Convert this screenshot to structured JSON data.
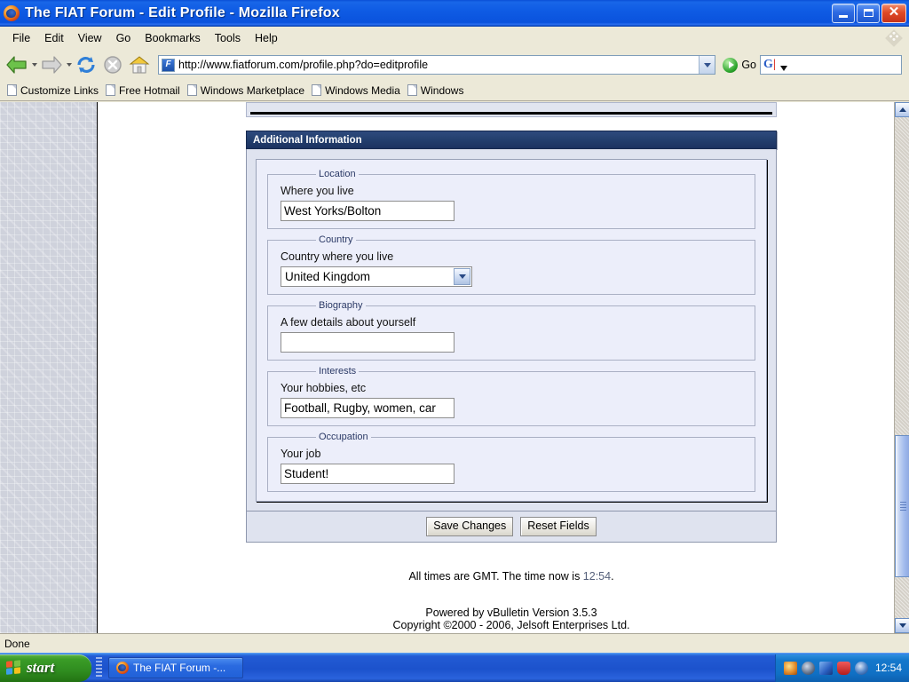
{
  "window": {
    "title": "The FIAT Forum - Edit Profile - Mozilla Firefox",
    "app_icon": "firefox-icon",
    "minimize_label": "Minimize",
    "maximize_label": "Restore",
    "close_label": "Close"
  },
  "menubar": {
    "items": [
      {
        "label": "File"
      },
      {
        "label": "Edit"
      },
      {
        "label": "View"
      },
      {
        "label": "Go"
      },
      {
        "label": "Bookmarks"
      },
      {
        "label": "Tools"
      },
      {
        "label": "Help"
      }
    ]
  },
  "toolbar": {
    "back_label": "Back",
    "forward_label": "Forward",
    "reload_label": "Reload",
    "stop_label": "Stop",
    "home_label": "Home",
    "url": "http://www.fiatforum.com/profile.php?do=editprofile",
    "go_label": "Go",
    "search_value": "",
    "search_placeholder": ""
  },
  "bookmarks": [
    {
      "label": "Customize Links"
    },
    {
      "label": "Free Hotmail"
    },
    {
      "label": "Windows Marketplace"
    },
    {
      "label": "Windows Media"
    },
    {
      "label": "Windows"
    }
  ],
  "page": {
    "panel_title": "Additional Information",
    "fieldsets": [
      {
        "legend": "Location",
        "description": "Where you live",
        "control": "text",
        "value": "West Yorks/Bolton"
      },
      {
        "legend": "Country",
        "description": "Country where you live",
        "control": "select",
        "value": "United Kingdom"
      },
      {
        "legend": "Biography",
        "description": "A few details about yourself",
        "control": "text",
        "value": ""
      },
      {
        "legend": "Interests",
        "description": "Your hobbies, etc",
        "control": "text",
        "value": "Football, Rugby, women, car"
      },
      {
        "legend": "Occupation",
        "description": "Your job",
        "control": "text",
        "value": "Student!"
      }
    ],
    "buttons": {
      "save": "Save Changes",
      "reset": "Reset Fields"
    },
    "footer": {
      "times_prefix": "All times are GMT. The time now is ",
      "time": "12:54",
      "times_suffix": ".",
      "powered": "Powered by vBulletin Version 3.5.3",
      "copyright": "Copyright ©2000 - 2006, Jelsoft Enterprises Ltd."
    }
  },
  "statusbar": {
    "text": "Done"
  },
  "taskbar": {
    "start_label": "start",
    "tasks": [
      {
        "label": "The FIAT Forum -...",
        "icon": "firefox-icon"
      }
    ],
    "tray_icons": [
      "network-icon",
      "shield-icon",
      "display-icon",
      "antivirus-icon",
      "volume-icon"
    ],
    "clock": "12:54"
  },
  "colors": {
    "titlebar_blue": "#0f5ce4",
    "panel_header_navy": "#24406f",
    "panel_body": "#dfe3ef",
    "inner_box": "#eceefa",
    "chrome_beige": "#ece9d8",
    "taskbar_blue": "#225bd4",
    "start_green": "#3a9c27"
  }
}
